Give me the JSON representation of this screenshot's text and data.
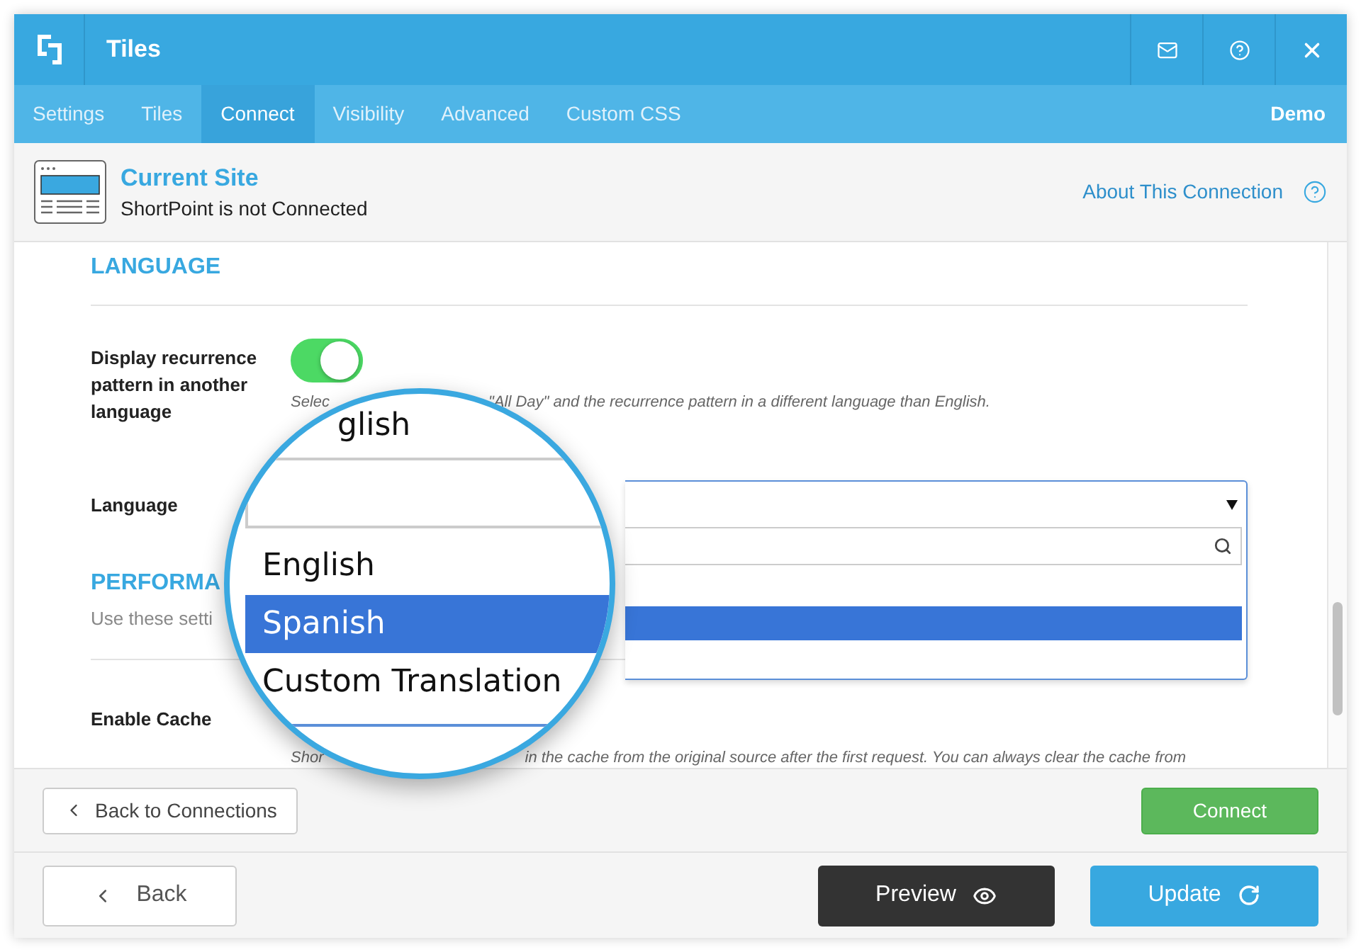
{
  "header": {
    "title": "Tiles"
  },
  "tabs": [
    {
      "label": "Settings",
      "selected": false
    },
    {
      "label": "Tiles",
      "selected": false
    },
    {
      "label": "Connect",
      "selected": true
    },
    {
      "label": "Visibility",
      "selected": false
    },
    {
      "label": "Advanced",
      "selected": false
    },
    {
      "label": "Custom CSS",
      "selected": false
    }
  ],
  "mode_label": "Demo",
  "site": {
    "title": "Current Site",
    "status": "ShortPoint is not Connected",
    "link": "About This Connection"
  },
  "language_section": {
    "heading": "LANGUAGE",
    "toggle": {
      "label": "Display recurrence pattern in another language",
      "on": true,
      "hint_parts": [
        "Selec",
        "\"All Day\" and the recurrence pattern in a different language than English."
      ]
    },
    "field_label": "Language"
  },
  "performance_section": {
    "heading": "PERFORMA",
    "description": "Use these setti",
    "cache": {
      "label": "Enable Cache",
      "hint_parts": [
        "Shor",
        "in the cache from the original source after the first request. You can always clear the cache from"
      ]
    }
  },
  "magnifier": {
    "cut_text": "glish",
    "options": [
      {
        "label": "English",
        "selected": false
      },
      {
        "label": "Spanish",
        "selected": true
      },
      {
        "label": "Custom Translation",
        "selected": false
      }
    ]
  },
  "footer": {
    "back_to_connections": "Back to Connections",
    "connect": "Connect",
    "back": "Back",
    "preview": "Preview",
    "update": "Update"
  }
}
